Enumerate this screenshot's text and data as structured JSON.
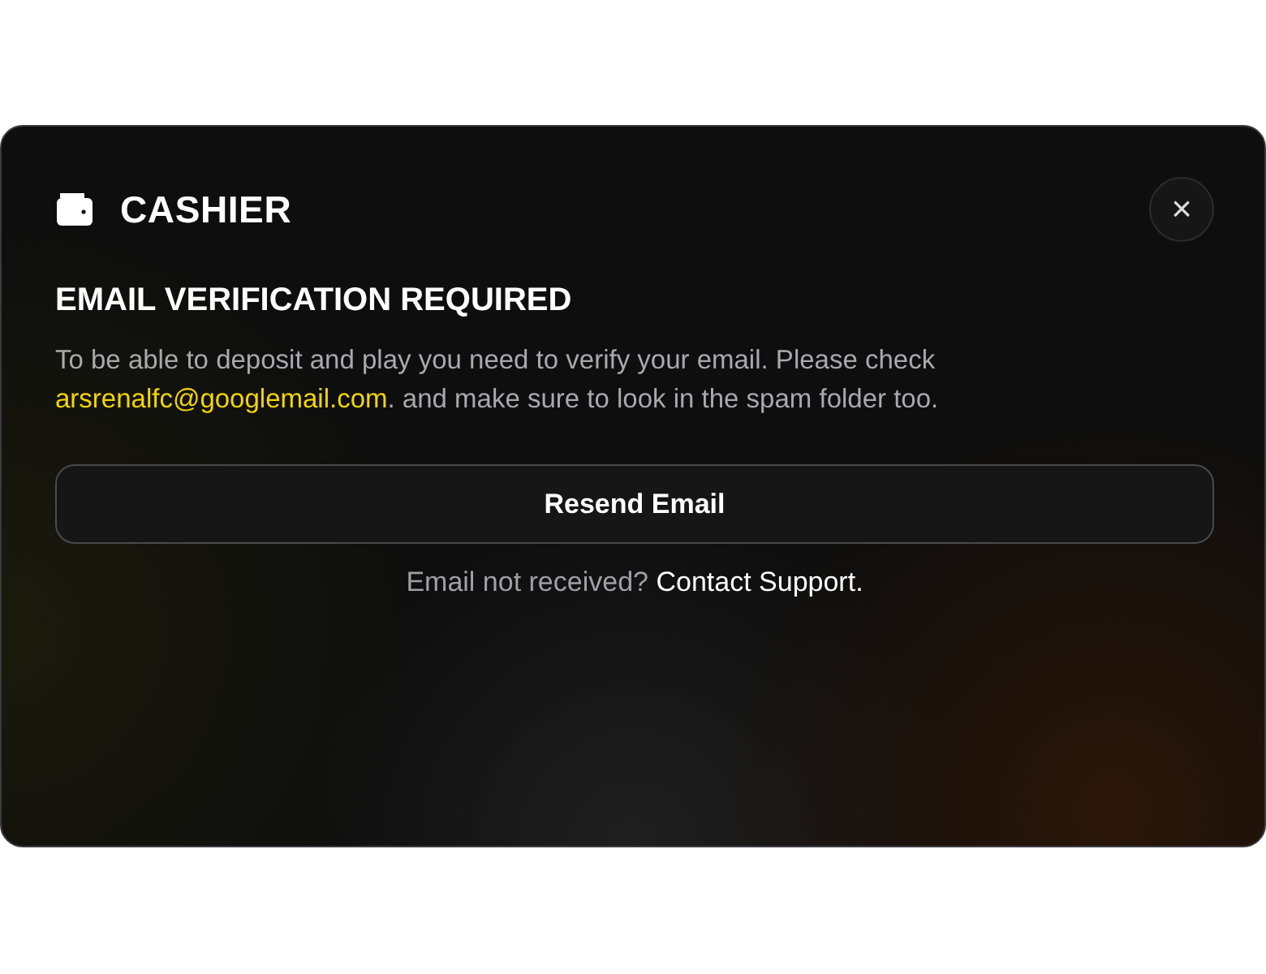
{
  "modal": {
    "title": "CASHIER",
    "close_label": "×"
  },
  "heading": "EMAIL VERIFICATION REQUIRED",
  "message": {
    "before": "To be able to deposit and play you need to verify your email. Please check ",
    "email": "arsrenalfc@googlemail.com",
    "after": ". and make sure to look in the spam folder too."
  },
  "resend_button": "Resend Email",
  "footer": {
    "text": "Email not received? ",
    "link": "Contact Support."
  }
}
